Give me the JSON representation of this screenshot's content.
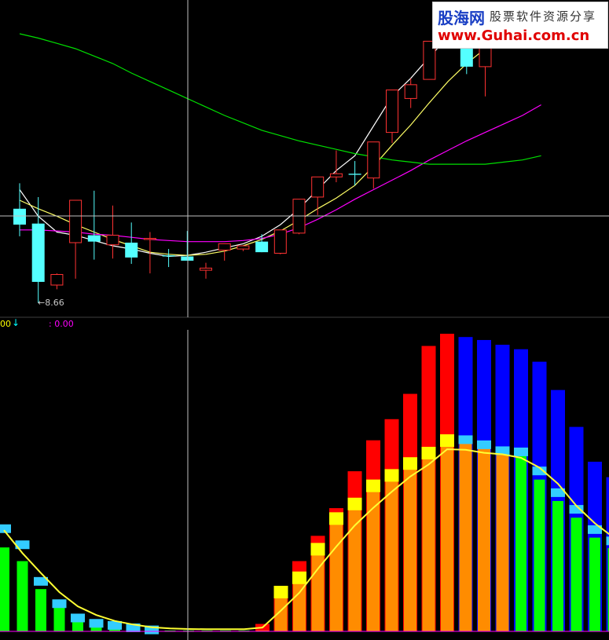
{
  "annotations": {
    "low_price_label": "8.66",
    "indicator_left_value": "00",
    "indicator_arrow": "↓",
    "indicator_right_value": ": 0.00"
  },
  "watermark": {
    "brand": "股海网",
    "slogan": "股票软件资源分享",
    "url": "www.Guhai.com.cn"
  },
  "colors": {
    "background": "#000000",
    "candle_up": "#ff3232",
    "candle_down": "#54ffff",
    "ma_white": "#ffffff",
    "ma_yellow": "#ffff66",
    "ma_magenta": "#ff00ff",
    "ma_green": "#00e000",
    "bar_red": "#ff0000",
    "bar_blue": "#0000ff",
    "bar_orange": "#ff8c00",
    "bar_green": "#00ff00",
    "cap_yellow": "#ffff00",
    "cap_cyan": "#33ccff",
    "curve_yellow": "#ffff33",
    "crosshair": "#c0c0c0"
  },
  "chart_data": [
    {
      "type": "candlestick",
      "title": "",
      "y_label_low": "8.66",
      "series": [
        {
          "name": "",
          "candles": [
            {
              "o": 9.42,
              "h": 9.66,
              "l": 9.16,
              "c": 9.27
            },
            {
              "o": 9.28,
              "h": 9.53,
              "l": 8.53,
              "c": 8.73
            },
            {
              "o": 8.7,
              "h": 8.81,
              "l": 8.66,
              "c": 8.8
            },
            {
              "o": 9.1,
              "h": 9.47,
              "l": 8.76,
              "c": 9.5
            },
            {
              "o": 9.17,
              "h": 9.59,
              "l": 8.94,
              "c": 9.11
            },
            {
              "o": 9.08,
              "h": 9.45,
              "l": 8.95,
              "c": 9.17
            },
            {
              "o": 9.1,
              "h": 9.29,
              "l": 8.9,
              "c": 8.96
            },
            {
              "o": 9.13,
              "h": 9.2,
              "l": 8.81,
              "c": 9.14
            },
            {
              "o": 8.98,
              "h": 9.04,
              "l": 8.87,
              "c": 8.97
            },
            {
              "o": 8.97,
              "h": 9.21,
              "l": 8.97,
              "c": 8.93
            },
            {
              "o": 8.84,
              "h": 8.91,
              "l": 8.76,
              "c": 8.86
            },
            {
              "o": 9.03,
              "h": 9.04,
              "l": 8.93,
              "c": 9.09
            },
            {
              "o": 9.04,
              "h": 9.06,
              "l": 9.02,
              "c": 9.07
            },
            {
              "o": 9.11,
              "h": 9.18,
              "l": 9.04,
              "c": 9.01
            },
            {
              "o": 9.0,
              "h": 9.12,
              "l": 8.99,
              "c": 9.22
            },
            {
              "o": 9.19,
              "h": 9.3,
              "l": 9.18,
              "c": 9.51
            },
            {
              "o": 9.53,
              "h": 9.66,
              "l": 9.36,
              "c": 9.72
            },
            {
              "o": 9.72,
              "h": 9.97,
              "l": 9.67,
              "c": 9.75
            },
            {
              "o": 9.75,
              "h": 9.87,
              "l": 9.64,
              "c": 9.74
            },
            {
              "o": 9.71,
              "h": 10.05,
              "l": 9.61,
              "c": 10.05
            },
            {
              "o": 10.14,
              "h": 10.46,
              "l": 10.04,
              "c": 10.54
            },
            {
              "o": 10.46,
              "h": 10.65,
              "l": 10.37,
              "c": 10.59
            },
            {
              "o": 10.64,
              "h": 10.89,
              "l": 10.64,
              "c": 11.0
            },
            {
              "o": 11.03,
              "h": 11.33,
              "l": 11.0,
              "c": 11.32
            },
            {
              "o": 11.35,
              "h": 11.35,
              "l": 10.69,
              "c": 10.76
            },
            {
              "o": 10.76,
              "h": 10.95,
              "l": 10.48,
              "c": 11.05
            },
            {
              "o": 11.05,
              "h": 11.08,
              "l": 11.02,
              "c": 11.22
            },
            {
              "o": 11.24,
              "h": 11.2,
              "l": 11.11,
              "c": 11.27
            },
            {
              "o": 11.29,
              "h": 11.29,
              "l": 11.12,
              "c": 11.16
            }
          ]
        }
      ],
      "ma_series": [
        {
          "name": "",
          "color": "#ffffff",
          "values": [
            9.6,
            9.35,
            9.2,
            9.17,
            9.12,
            9.07,
            9.04,
            9.0,
            8.97,
            8.98,
            9.01,
            9.05,
            9.09,
            9.16,
            9.27,
            9.42,
            9.6,
            9.78,
            9.92,
            10.2,
            10.48,
            10.65,
            10.85,
            11.04,
            11.12,
            11.17,
            11.21,
            11.25,
            11.27
          ]
        },
        {
          "name": "",
          "color": "#ffff66",
          "values": [
            9.5,
            9.42,
            9.35,
            9.27,
            9.2,
            9.13,
            9.07,
            9.01,
            8.99,
            8.98,
            8.99,
            9.02,
            9.07,
            9.13,
            9.21,
            9.31,
            9.42,
            9.52,
            9.64,
            9.82,
            10.02,
            10.21,
            10.42,
            10.62,
            10.79,
            10.93,
            11.04,
            11.12,
            11.17
          ]
        },
        {
          "name": "",
          "color": "#ff00ff",
          "values": [
            9.22,
            9.22,
            9.21,
            9.2,
            9.18,
            9.17,
            9.15,
            9.13,
            9.12,
            9.11,
            9.11,
            9.11,
            9.12,
            9.14,
            9.18,
            9.24,
            9.32,
            9.41,
            9.51,
            9.6,
            9.69,
            9.78,
            9.88,
            9.97,
            10.06,
            10.14,
            10.22,
            10.3,
            10.4
          ]
        },
        {
          "name": "",
          "color": "#00e000",
          "values": [
            11.07,
            11.03,
            10.98,
            10.93,
            10.86,
            10.79,
            10.7,
            10.62,
            10.54,
            10.46,
            10.38,
            10.3,
            10.23,
            10.16,
            10.11,
            10.06,
            10.02,
            9.98,
            9.94,
            9.91,
            9.88,
            9.86,
            9.84,
            9.84,
            9.84,
            9.84,
            9.86,
            9.88,
            9.92
          ]
        }
      ]
    },
    {
      "type": "bar",
      "title": "",
      "ylim": [
        0,
        100
      ],
      "series": [
        {
          "name": "",
          "values": [
            0.0,
            0.0,
            0.0,
            0.0,
            0.0,
            0.0,
            0.0,
            0.0,
            0.0,
            0.0,
            0.0,
            0.0,
            0.0,
            0.0,
            2.5,
            13.0,
            23.6,
            32.1,
            41.4,
            53.8,
            64.2,
            71.3,
            79.8,
            95.9,
            100.0,
            98.9,
            97.9,
            96.3,
            94.8,
            90.6,
            81.1,
            68.7,
            57.0,
            51.8,
            46.1
          ]
        },
        {
          "name": "",
          "values": [
            34.5,
            29.1,
            16.8,
            9.3,
            4.5,
            2.7,
            2.0,
            1.2,
            0.5,
            0.3,
            0.3,
            0.3,
            0.3,
            0.3,
            0.3,
            13.2,
            18.0,
            27.6,
            37.9,
            42.8,
            48.9,
            52.4,
            56.4,
            59.9,
            64.1,
            64.4,
            62.7,
            60.7,
            60.3,
            53.9,
            46.6,
            41.0,
            34.2,
            30.4,
            24.9
          ]
        },
        {
          "name": "",
          "values": [
            28.2,
            23.6,
            14.2,
            8.2,
            4.2,
            2.5,
            1.5,
            0.7,
            0.3,
            0.3,
            0.3,
            0.3,
            0.3,
            0.3,
            2.4,
            9.1,
            14.4,
            24.0,
            32.5,
            37.5,
            44.5,
            48.0,
            52.0,
            55.3,
            60.5,
            62.4,
            61.1,
            60.0,
            59.6,
            51.0,
            43.8,
            38.2,
            31.5,
            28.0,
            22.7
          ]
        }
      ],
      "curve": [
        34.0,
        26.3,
        19.6,
        13.2,
        8.4,
        5.5,
        3.5,
        2.3,
        1.4,
        1.0,
        0.8,
        0.7,
        0.7,
        0.7,
        1.3,
        7.0,
        13.0,
        21.0,
        28.5,
        35.6,
        41.5,
        46.9,
        52.0,
        56.1,
        61.2,
        61.0,
        60.0,
        59.5,
        58.3,
        55.0,
        49.6,
        42.2,
        36.3,
        31.6,
        27.4
      ]
    }
  ]
}
